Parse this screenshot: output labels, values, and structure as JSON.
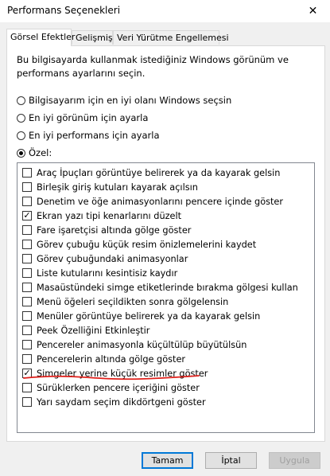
{
  "window": {
    "title": "Performans Seçenekleri",
    "close_glyph": "✕"
  },
  "tabs": [
    {
      "label": "Görsel Efektler",
      "active": true
    },
    {
      "label": "Gelişmiş",
      "active": false
    },
    {
      "label": "Veri Yürütme Engellemesi",
      "active": false
    }
  ],
  "description": "Bu bilgisayarda kullanmak istediğiniz Windows görünüm ve performans ayarlarını seçin.",
  "radios": [
    {
      "label": "Bilgisayarım için en iyi olanı Windows seçsin",
      "selected": false
    },
    {
      "label": "En iyi görünüm için ayarla",
      "selected": false
    },
    {
      "label": "En iyi performans için ayarla",
      "selected": false
    },
    {
      "label": "Özel:",
      "selected": true
    }
  ],
  "effects": [
    {
      "label": "Araç İpuçları görüntüye belirerek ya da kayarak gelsin",
      "checked": false
    },
    {
      "label": "Birleşik giriş kutuları kayarak açılsın",
      "checked": false
    },
    {
      "label": "Denetim ve öğe animasyonlarını pencere içinde göster",
      "checked": false
    },
    {
      "label": "Ekran yazı tipi kenarlarını düzelt",
      "checked": true
    },
    {
      "label": "Fare işaretçisi altında gölge göster",
      "checked": false
    },
    {
      "label": "Görev çubuğu küçük resim önizlemelerini kaydet",
      "checked": false
    },
    {
      "label": "Görev çubuğundaki animasyonlar",
      "checked": false
    },
    {
      "label": "Liste kutularını kesintisiz kaydır",
      "checked": false
    },
    {
      "label": "Masaüstündeki simge etiketlerinde bırakma gölgesi kullan",
      "checked": false
    },
    {
      "label": "Menü öğeleri seçildikten sonra gölgelensin",
      "checked": false
    },
    {
      "label": "Menüler görüntüye belirerek ya da kayarak gelsin",
      "checked": false
    },
    {
      "label": "Peek Özelliğini Etkinleştir",
      "checked": false
    },
    {
      "label": "Pencereler animasyonla küçültülüp büyütülsün",
      "checked": false
    },
    {
      "label": "Pencerelerin altında gölge göster",
      "checked": false
    },
    {
      "label": "Simgeler yerine küçük resimler göster",
      "checked": true
    },
    {
      "label": "Sürüklerken pencere içeriğini göster",
      "checked": false
    },
    {
      "label": "Yarı saydam seçim dikdörtgeni göster",
      "checked": false
    }
  ],
  "buttons": {
    "ok": "Tamam",
    "cancel": "İptal",
    "apply": "Uygula"
  },
  "colors": {
    "annotation": "#e0201b",
    "default_button_border": "#0078d7"
  }
}
